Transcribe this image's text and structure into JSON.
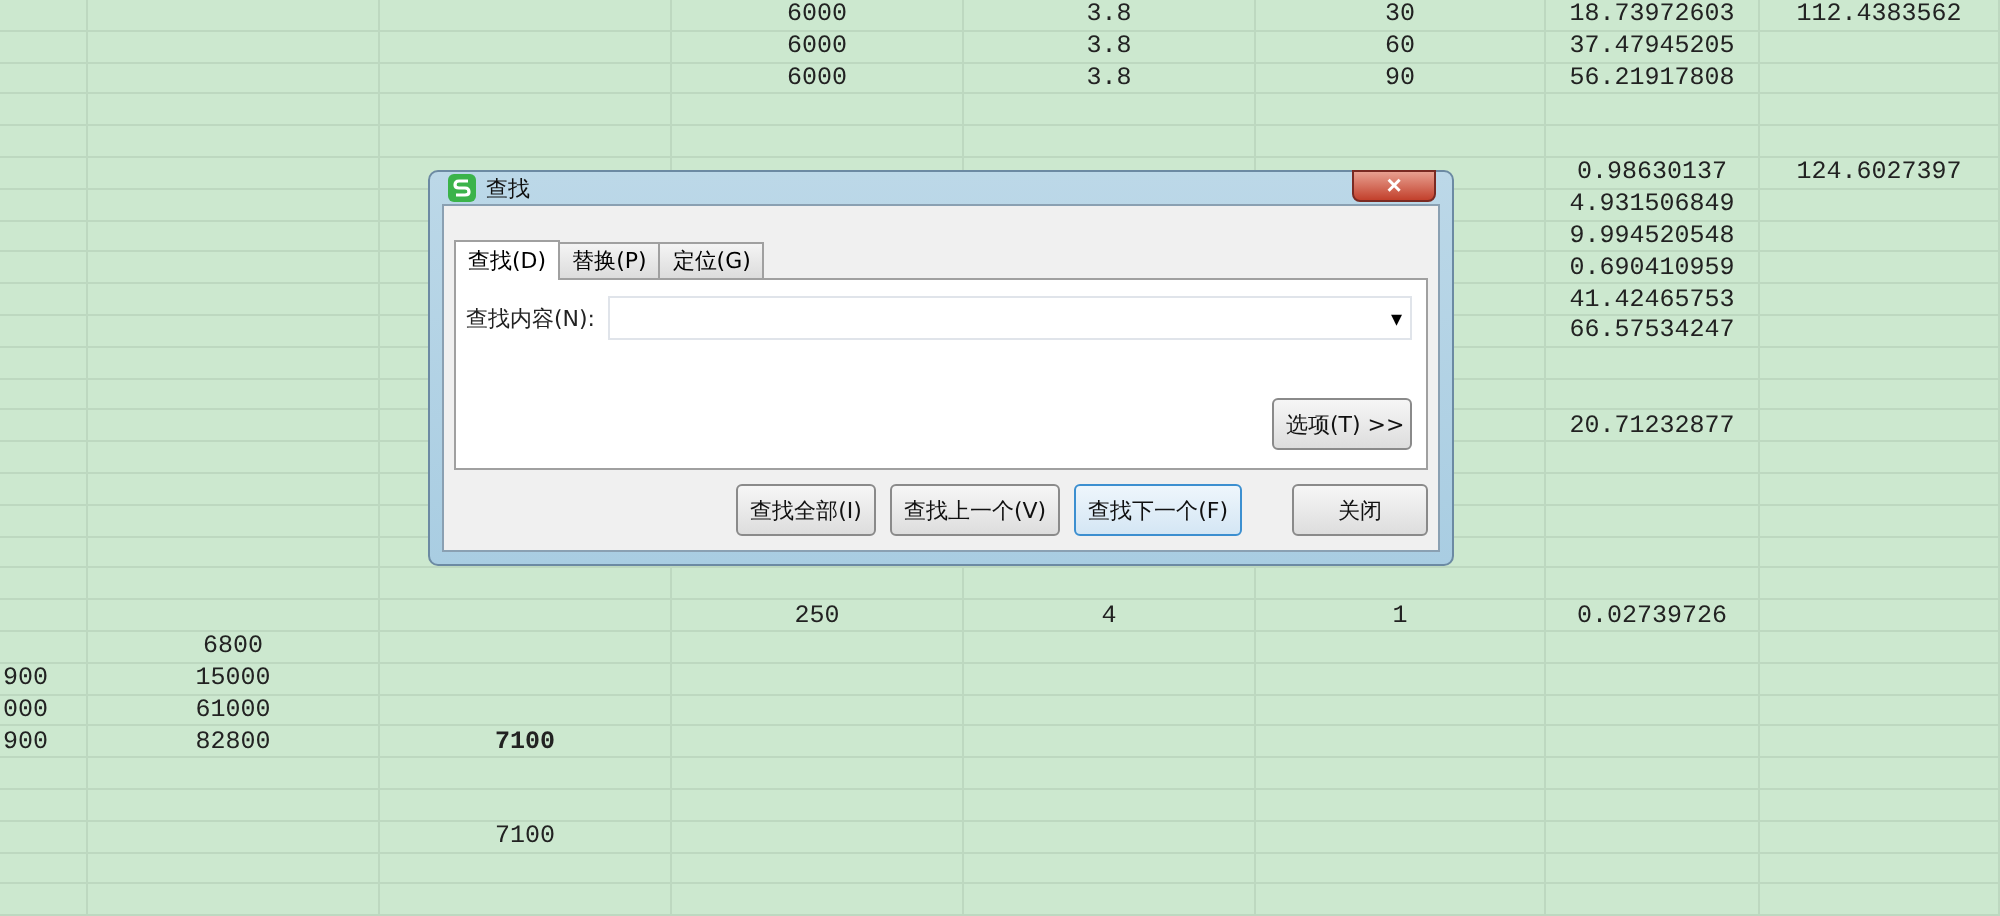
{
  "sheet": {
    "rows": [
      {
        "cells": [
          null,
          null,
          null,
          {
            "text": "6000",
            "bold": false
          },
          {
            "text": "3.8",
            "bold": false
          },
          {
            "text": "30",
            "bold": false
          },
          {
            "text": "18.73972603",
            "bold": false
          },
          {
            "text": "112.4383562",
            "bold": false
          }
        ]
      },
      {
        "cells": [
          null,
          null,
          null,
          {
            "text": "6000",
            "bold": false
          },
          {
            "text": "3.8",
            "bold": false
          },
          {
            "text": "60",
            "bold": false
          },
          {
            "text": "37.47945205",
            "bold": false
          },
          null
        ]
      },
      {
        "cells": [
          null,
          null,
          null,
          {
            "text": "6000",
            "bold": false
          },
          {
            "text": "3.8",
            "bold": false
          },
          {
            "text": "90",
            "bold": false
          },
          {
            "text": "56.21917808",
            "bold": false
          },
          null
        ]
      },
      {
        "cells": [
          null,
          null,
          null,
          null,
          null,
          null,
          null,
          null
        ]
      },
      {
        "cells": [
          null,
          null,
          null,
          null,
          null,
          null,
          null,
          null
        ]
      },
      {
        "cells": [
          null,
          null,
          null,
          null,
          null,
          null,
          {
            "text": "0.98630137",
            "bold": false
          },
          {
            "text": "124.6027397",
            "bold": false
          }
        ]
      },
      {
        "cells": [
          null,
          null,
          null,
          null,
          null,
          null,
          {
            "text": "4.931506849",
            "bold": false
          },
          null
        ]
      },
      {
        "cells": [
          null,
          null,
          null,
          null,
          null,
          null,
          {
            "text": "9.994520548",
            "bold": false
          },
          null
        ]
      },
      {
        "cells": [
          null,
          null,
          null,
          null,
          null,
          null,
          {
            "text": "0.690410959",
            "bold": false
          },
          null
        ]
      },
      {
        "cells": [
          null,
          null,
          null,
          null,
          null,
          null,
          {
            "text": "41.42465753",
            "bold": false
          },
          null
        ]
      },
      {
        "cells": [
          null,
          null,
          null,
          null,
          null,
          null,
          {
            "text": "66.57534247",
            "bold": false
          },
          null
        ]
      },
      {
        "cells": [
          null,
          null,
          null,
          null,
          null,
          null,
          null,
          null
        ]
      },
      {
        "cells": [
          null,
          null,
          null,
          null,
          null,
          null,
          null,
          null
        ]
      },
      {
        "cells": [
          null,
          null,
          null,
          null,
          null,
          null,
          {
            "text": "20.71232877",
            "bold": false
          },
          null
        ]
      },
      {
        "cells": [
          null,
          null,
          null,
          null,
          null,
          null,
          null,
          null
        ]
      },
      {
        "cells": [
          null,
          null,
          null,
          null,
          null,
          null,
          null,
          null
        ]
      },
      {
        "cells": [
          null,
          null,
          null,
          null,
          null,
          null,
          null,
          null
        ]
      },
      {
        "cells": [
          null,
          null,
          null,
          null,
          null,
          null,
          null,
          null
        ]
      },
      {
        "cells": [
          null,
          null,
          null,
          null,
          null,
          null,
          null,
          null
        ]
      },
      {
        "cells": [
          null,
          null,
          null,
          {
            "text": "250",
            "bold": false
          },
          {
            "text": "4",
            "bold": false
          },
          {
            "text": "1",
            "bold": false
          },
          {
            "text": "0.02739726",
            "bold": false
          },
          null
        ]
      },
      {
        "cells": [
          null,
          {
            "text": "6800",
            "bold": false
          },
          null,
          null,
          null,
          null,
          null,
          null
        ]
      },
      {
        "cells": [
          {
            "text": "900",
            "bold": false
          },
          {
            "text": "15000",
            "bold": false
          },
          null,
          null,
          null,
          null,
          null,
          null
        ]
      },
      {
        "cells": [
          {
            "text": "000",
            "bold": false
          },
          {
            "text": "61000",
            "bold": false
          },
          null,
          null,
          null,
          null,
          null,
          null
        ]
      },
      {
        "cells": [
          {
            "text": "900",
            "bold": false
          },
          {
            "text": "82800",
            "bold": false
          },
          {
            "text": "7100",
            "bold": true
          },
          null,
          null,
          null,
          null,
          null
        ]
      },
      {
        "cells": [
          null,
          null,
          null,
          null,
          null,
          null,
          null,
          null
        ]
      },
      {
        "cells": [
          null,
          null,
          null,
          null,
          null,
          null,
          null,
          null
        ]
      },
      {
        "cells": [
          null,
          null,
          {
            "text": "7100",
            "bold": false
          },
          null,
          null,
          null,
          null,
          null
        ]
      },
      {
        "cells": [
          null,
          null,
          null,
          null,
          null,
          null,
          null,
          null
        ]
      },
      {
        "cells": [
          null,
          null,
          null,
          null,
          null,
          null,
          null,
          null
        ]
      }
    ]
  },
  "dialog": {
    "title": "查找",
    "tabs": [
      {
        "label": "查找(D)",
        "selected": true
      },
      {
        "label": "替换(P)",
        "selected": false
      },
      {
        "label": "定位(G)",
        "selected": false
      }
    ],
    "find_label": "查找内容(N):",
    "dropdown_arrow": "▾",
    "options_button": "选项(T) >>",
    "buttons": [
      {
        "label": "查找全部(I)",
        "default": false
      },
      {
        "label": "查找上一个(V)",
        "default": false
      },
      {
        "label": "查找下一个(F)",
        "default": true
      }
    ],
    "close_button": "关闭",
    "close_glyph": "×"
  }
}
